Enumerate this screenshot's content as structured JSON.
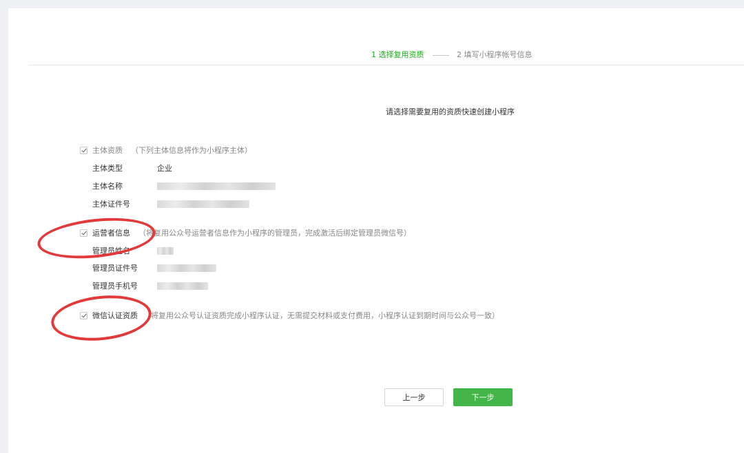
{
  "steps": {
    "step1": "1 选择复用资质",
    "step2": "2 填写小程序帐号信息"
  },
  "prompt": "请选择需要复用的资质快速创建小程序",
  "subject": {
    "title": "主体资质",
    "note": "（下列主体信息将作为小程序主体）",
    "rows": [
      {
        "label": "主体类型",
        "value": "企业"
      },
      {
        "label": "主体名称",
        "value": ""
      },
      {
        "label": "主体证件号",
        "value": ""
      }
    ]
  },
  "operator": {
    "title": "运营者信息",
    "note": "（将复用公众号运营者信息作为小程序的管理员，完成激活后绑定管理员微信号）",
    "rows": [
      {
        "label": "管理员姓名",
        "value": ""
      },
      {
        "label": "管理员证件号",
        "value": ""
      },
      {
        "label": "管理员手机号",
        "value": ""
      }
    ]
  },
  "wechat_cert": {
    "title": "微信认证资质",
    "note": "（将复用公众号认证资质完成小程序认证，无需提交材料或支付费用，小程序认证到期时间与公众号一致）"
  },
  "buttons": {
    "prev": "上一步",
    "next": "下一步"
  },
  "colors": {
    "accent_green": "#1aad19",
    "button_green": "#44b549",
    "annotation_red": "#e23a3a"
  }
}
